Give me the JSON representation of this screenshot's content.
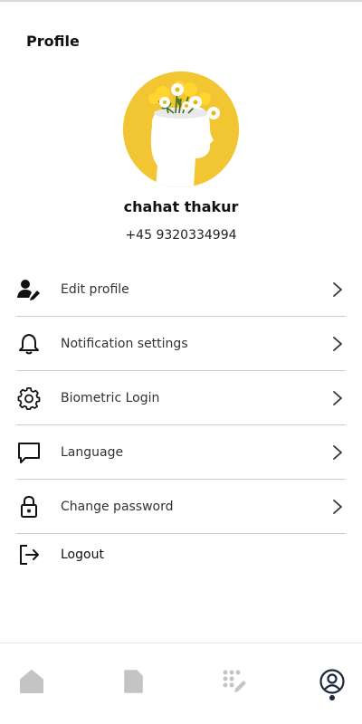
{
  "header": {
    "title": "Profile"
  },
  "profile": {
    "name": "chahat thakur",
    "phone": "+45  9320334994",
    "avatar_bg": "#f2c532"
  },
  "menu": {
    "items": [
      {
        "label": "Edit profile",
        "icon": "edit-user-icon"
      },
      {
        "label": "Notification settings",
        "icon": "bell-icon"
      },
      {
        "label": "Biometric Login",
        "icon": "gear-icon"
      },
      {
        "label": "Language",
        "icon": "chat-bubble-icon"
      },
      {
        "label": "Change password",
        "icon": "lock-icon"
      },
      {
        "label": "Logout",
        "icon": "logout-icon"
      }
    ]
  },
  "bottom_nav": {
    "items": [
      {
        "icon": "home-icon",
        "active": false
      },
      {
        "icon": "document-icon",
        "active": false
      },
      {
        "icon": "dial-pad-edit-icon",
        "active": false
      },
      {
        "icon": "profile-icon",
        "active": true
      }
    ],
    "active_color": "#1a2a3a",
    "inactive_color": "#c4c4c4"
  }
}
